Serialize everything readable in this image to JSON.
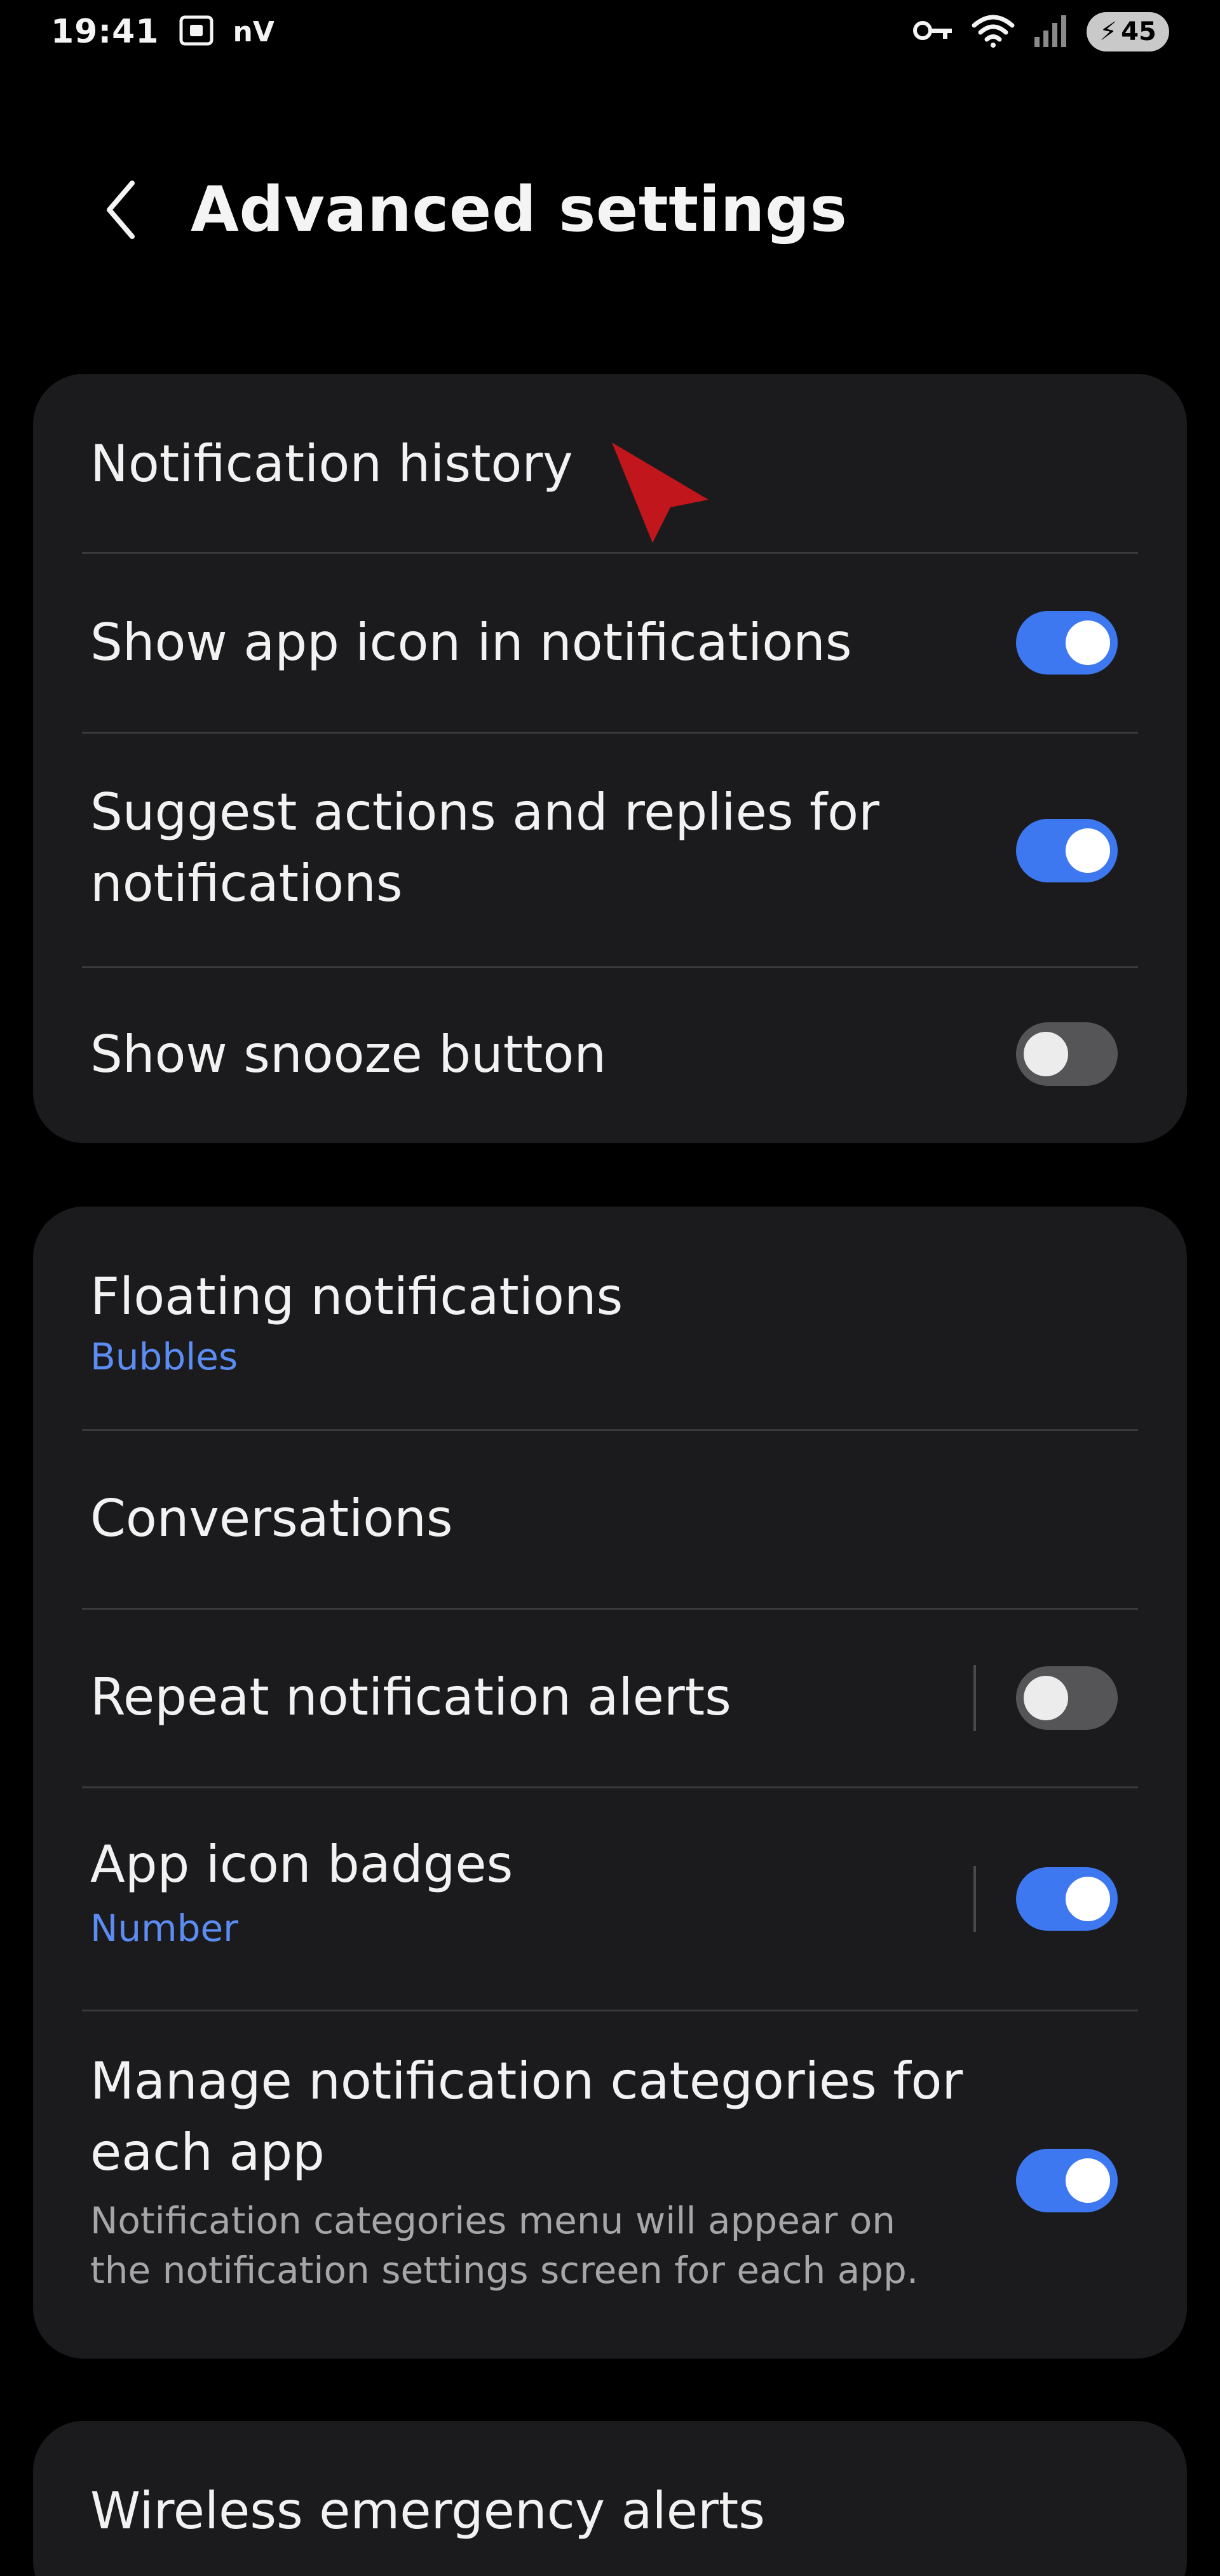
{
  "status_bar": {
    "time": "19:41",
    "left_icons": [
      "screenshot-icon",
      "nv-icon"
    ],
    "nv_label": "nV",
    "right_icons": [
      "key-icon",
      "wifi-icon",
      "signal-icon"
    ],
    "battery": "45"
  },
  "header": {
    "title": "Advanced settings",
    "back_icon": "chevron-left-icon"
  },
  "card1": {
    "notification_history": "Notification history",
    "show_app_icon": {
      "label": "Show app icon in notifications",
      "enabled": true
    },
    "suggest_actions": {
      "label_line1": "Suggest actions and replies for",
      "label_line2": "notifications",
      "enabled": true
    },
    "snooze_button": {
      "label": "Show snooze button",
      "enabled": false
    }
  },
  "card2": {
    "floating": {
      "label": "Floating notifications",
      "value": "Bubbles"
    },
    "conversations": "Conversations",
    "repeat_alerts": {
      "label": "Repeat notification alerts",
      "enabled": false
    },
    "badges": {
      "label": "App icon badges",
      "value": "Number",
      "enabled": true
    },
    "categories": {
      "label_line1": "Manage notification categories for",
      "label_line2": "each app",
      "desc_line1": "Notification categories menu will appear on",
      "desc_line2": "the notification settings screen for each app.",
      "enabled": true
    }
  },
  "card3": {
    "emergency": "Wireless emergency alerts"
  },
  "colors": {
    "background": "#000000",
    "card": "#1b1b1d",
    "accent": "#3e78f0",
    "subtext_blue": "#5b8df5",
    "cursor": "#c0161c"
  }
}
